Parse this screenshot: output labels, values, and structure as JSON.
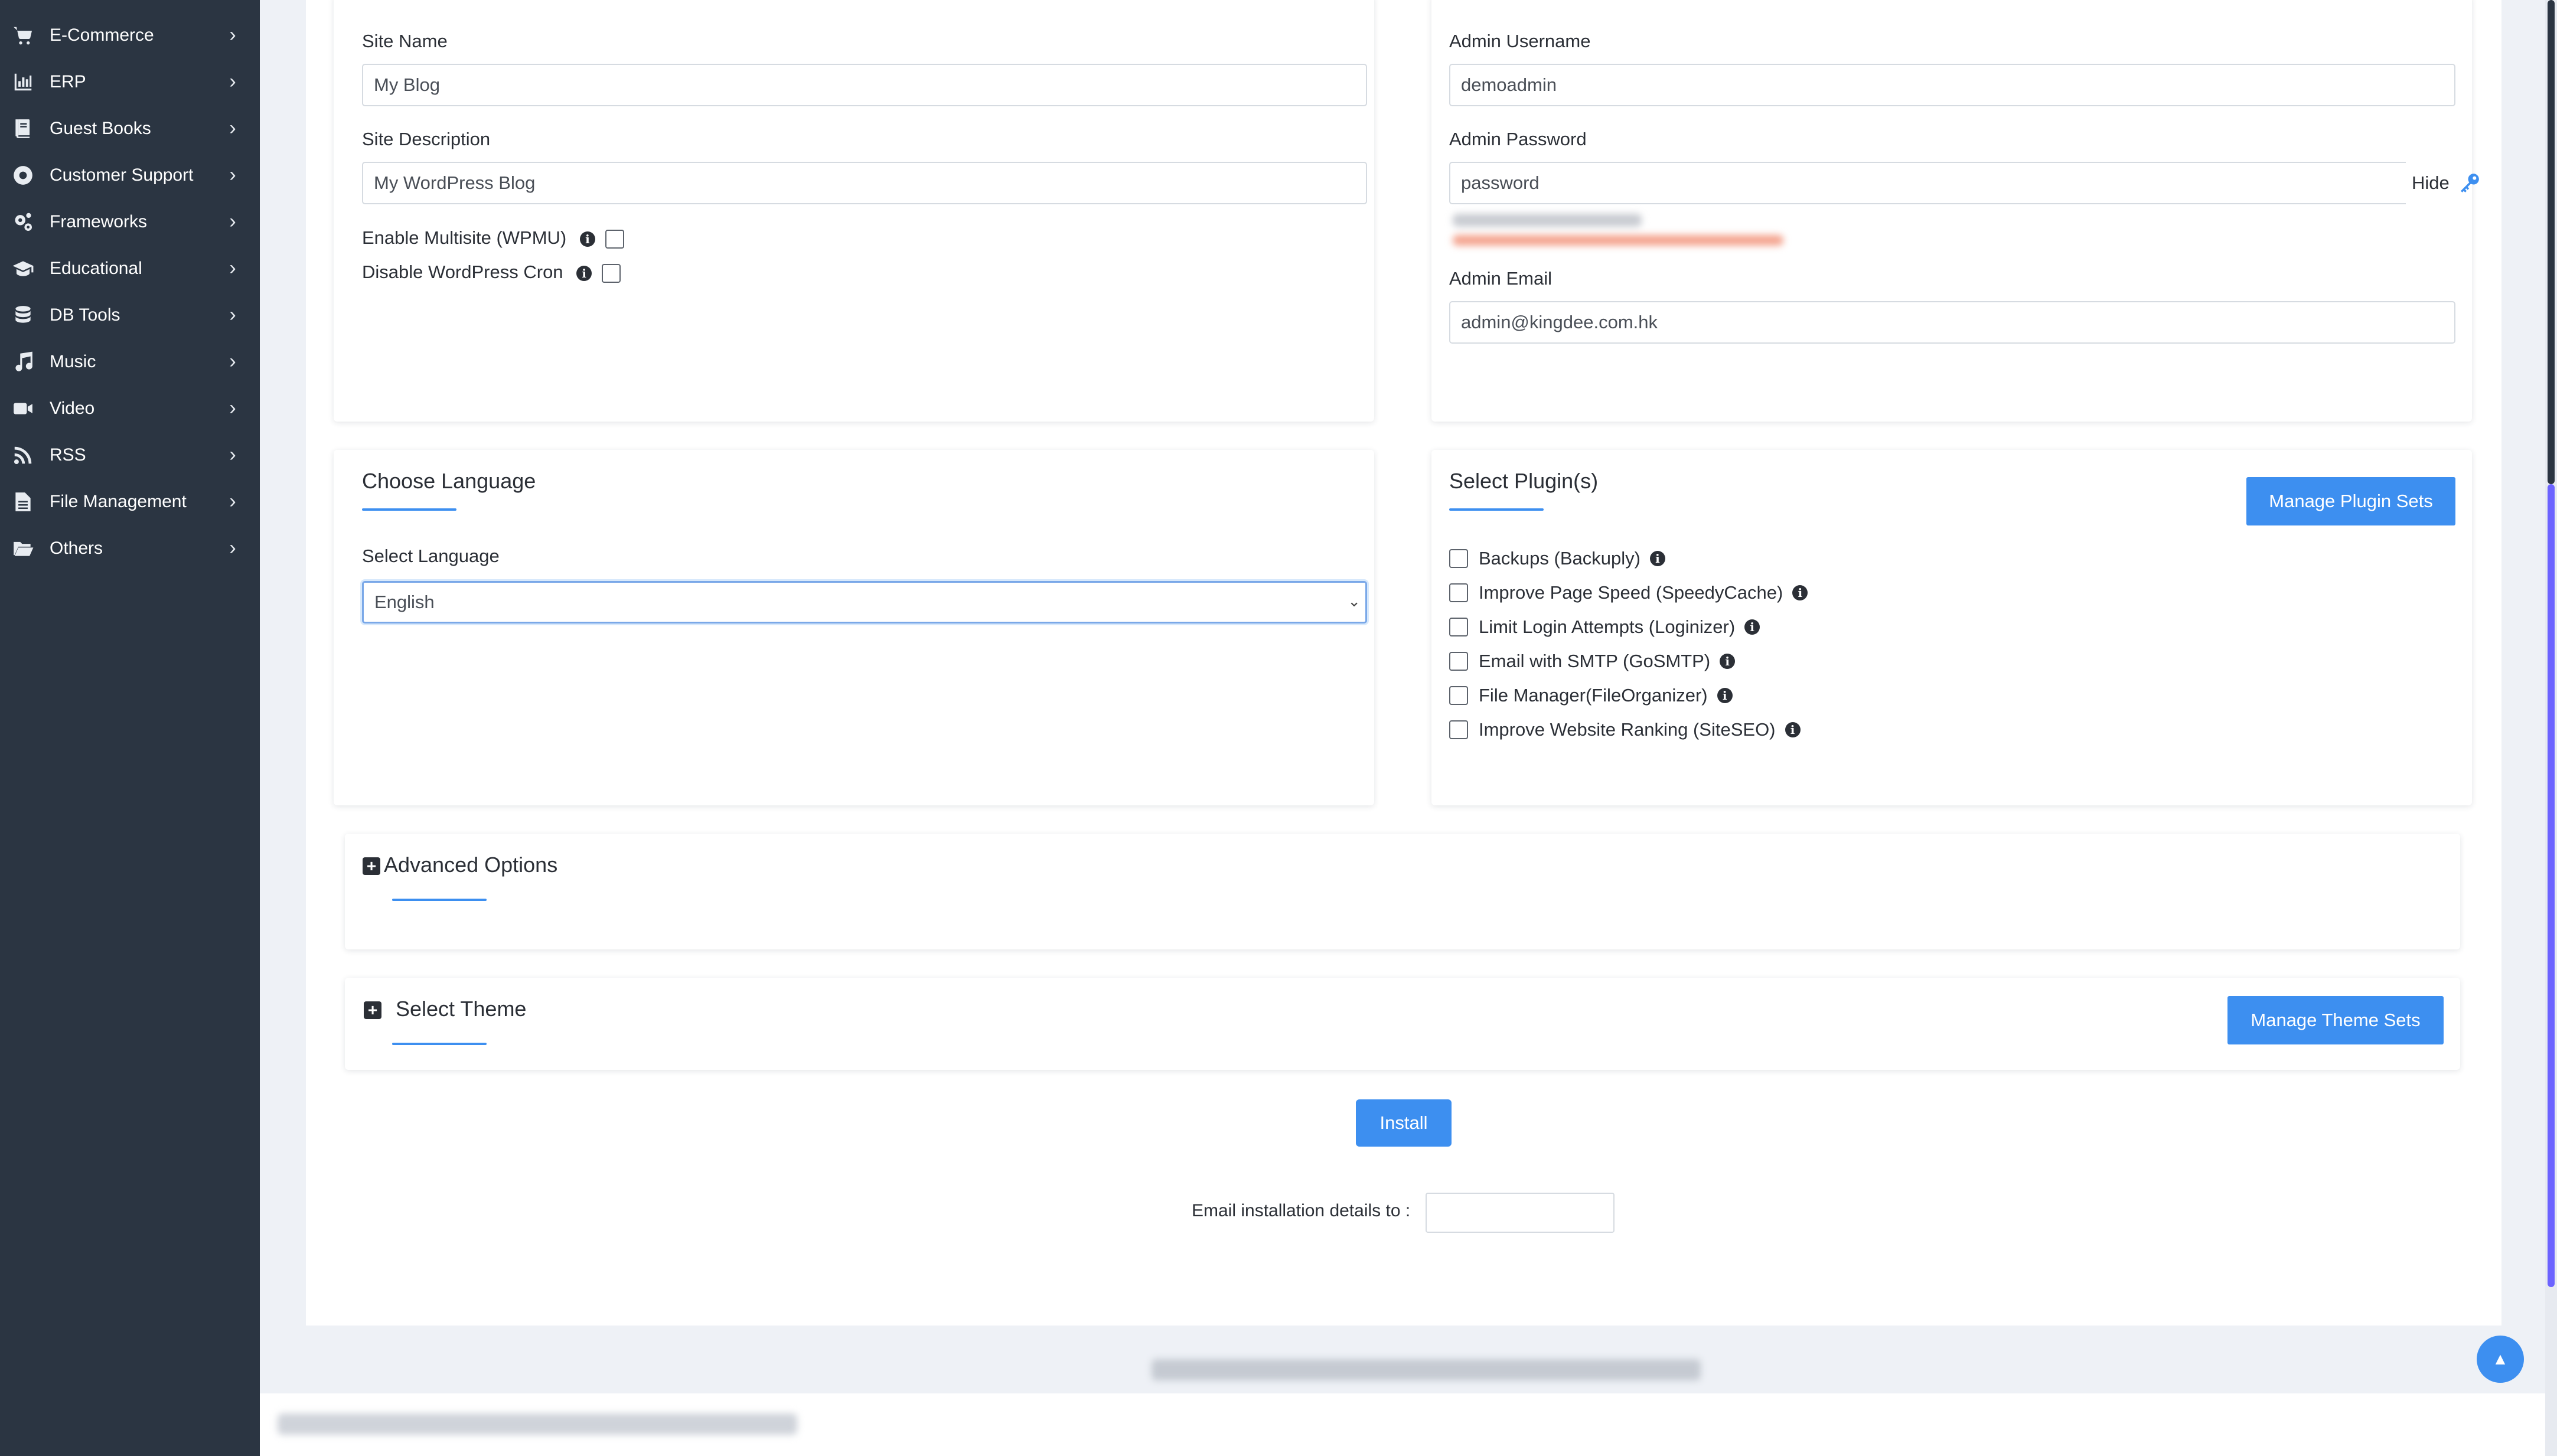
{
  "sidebar": {
    "items": [
      {
        "label": "E-Commerce",
        "icon": "cart-icon"
      },
      {
        "label": "ERP",
        "icon": "chart-icon"
      },
      {
        "label": "Guest Books",
        "icon": "book-icon"
      },
      {
        "label": "Customer Support",
        "icon": "lifebuoy-icon"
      },
      {
        "label": "Frameworks",
        "icon": "gears-icon"
      },
      {
        "label": "Educational",
        "icon": "graduation-cap-icon"
      },
      {
        "label": "DB Tools",
        "icon": "database-icon"
      },
      {
        "label": "Music",
        "icon": "music-note-icon"
      },
      {
        "label": "Video",
        "icon": "video-camera-icon"
      },
      {
        "label": "RSS",
        "icon": "rss-icon"
      },
      {
        "label": "File Management",
        "icon": "file-icon"
      },
      {
        "label": "Others",
        "icon": "folder-open-icon"
      }
    ]
  },
  "site_settings": {
    "site_name_label": "Site Name",
    "site_name_value": "My Blog",
    "site_desc_label": "Site Description",
    "site_desc_value": "My WordPress Blog",
    "multisite_label": "Enable Multisite (WPMU)",
    "cron_label": "Disable WordPress Cron"
  },
  "admin": {
    "username_label": "Admin Username",
    "username_value": "demoadmin",
    "password_label": "Admin Password",
    "password_value": "password",
    "hide_label": "Hide",
    "email_label": "Admin Email",
    "email_value": "admin@kingdee.com.hk"
  },
  "language": {
    "title": "Choose Language",
    "select_label": "Select Language",
    "selected": "English"
  },
  "plugins": {
    "title": "Select Plugin(s)",
    "manage_button": "Manage Plugin Sets",
    "items": [
      "Backups (Backuply)",
      "Improve Page Speed (SpeedyCache)",
      "Limit Login Attempts (Loginizer)",
      "Email with SMTP (GoSMTP)",
      "File Manager(FileOrganizer)",
      "Improve Website Ranking (SiteSEO)"
    ]
  },
  "advanced": {
    "title": "Advanced Options"
  },
  "theme": {
    "title": "Select Theme",
    "manage_button": "Manage Theme Sets"
  },
  "install": {
    "button": "Install",
    "email_label": "Email installation details to :"
  },
  "colors": {
    "accent": "#3d8ff0",
    "sidebar_bg": "#2b3542"
  }
}
